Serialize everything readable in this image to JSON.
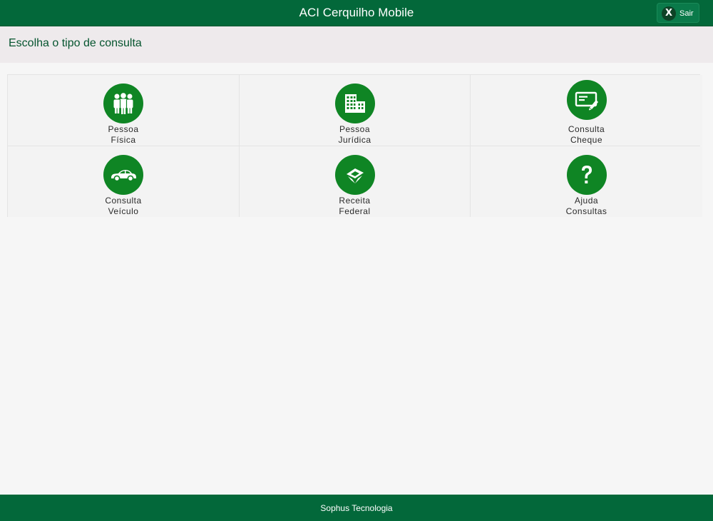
{
  "header": {
    "title": "ACI Cerquilho Mobile",
    "exit_label": "Sair",
    "exit_icon_glyph": "X"
  },
  "subheader": {
    "title": "Escolha o tipo de consulta"
  },
  "tiles": [
    {
      "line1": "Pessoa",
      "line2": "Física",
      "icon": "people-icon"
    },
    {
      "line1": "Pessoa",
      "line2": "Jurídica",
      "icon": "building-icon"
    },
    {
      "line1": "Consulta",
      "line2": "Cheque",
      "icon": "cheque-icon"
    },
    {
      "line1": "Consulta",
      "line2": "Veículo",
      "icon": "car-icon"
    },
    {
      "line1": "Receita",
      "line2": "Federal",
      "icon": "receita-federal-icon"
    },
    {
      "line1": "Ajuda",
      "line2": "Consultas",
      "icon": "help-icon"
    }
  ],
  "footer": {
    "text": "Sophus Tecnologia"
  },
  "colors": {
    "header_bg": "#03683a",
    "icon_bg": "#0f8524",
    "subheader_bg": "#eeeaec",
    "title_green": "#06552f"
  }
}
